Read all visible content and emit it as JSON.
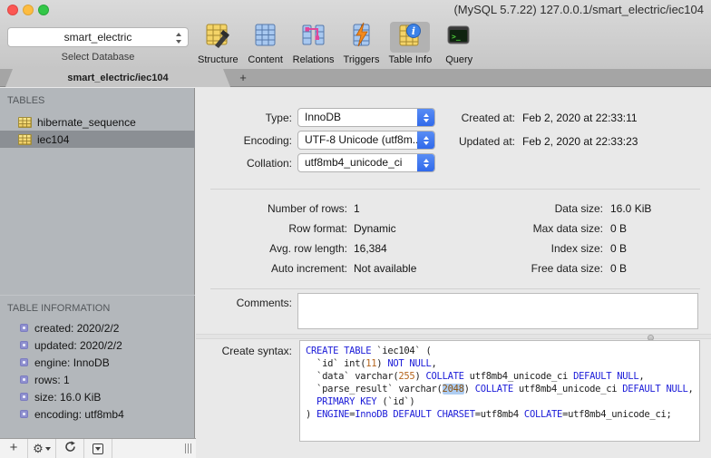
{
  "window": {
    "title": "(MySQL 5.7.22) 127.0.0.1/smart_electric/iec104"
  },
  "toolbar": {
    "database_select": {
      "value": "smart_electric",
      "label": "Select Database"
    },
    "buttons": [
      {
        "label": "Structure",
        "active": false
      },
      {
        "label": "Content",
        "active": false
      },
      {
        "label": "Relations",
        "active": false
      },
      {
        "label": "Triggers",
        "active": false
      },
      {
        "label": "Table Info",
        "active": true
      },
      {
        "label": "Query",
        "active": false
      }
    ]
  },
  "tabbar": {
    "active_tab": "smart_electric/iec104",
    "new_tab": "+"
  },
  "sidebar": {
    "tables_header": "TABLES",
    "tables": [
      {
        "name": "hibernate_sequence",
        "selected": false
      },
      {
        "name": "iec104",
        "selected": true
      }
    ],
    "info_header": "TABLE INFORMATION",
    "info_items": [
      "created: 2020/2/2",
      "updated: 2020/2/2",
      "engine: InnoDB",
      "rows: 1",
      "size: 16.0 KiB",
      "encoding: utf8mb4"
    ]
  },
  "main": {
    "type": {
      "label": "Type:",
      "value": "InnoDB"
    },
    "encoding": {
      "label": "Encoding:",
      "value": "UTF-8 Unicode (utf8m..."
    },
    "collation": {
      "label": "Collation:",
      "value": "utf8mb4_unicode_ci"
    },
    "created": {
      "label": "Created at:",
      "value": "Feb 2, 2020 at 22:33:11"
    },
    "updated": {
      "label": "Updated at:",
      "value": "Feb 2, 2020 at 22:33:23"
    },
    "stats_left": [
      {
        "label": "Number of rows:",
        "value": "1"
      },
      {
        "label": "Row format:",
        "value": "Dynamic"
      },
      {
        "label": "Avg. row length:",
        "value": "16,384"
      },
      {
        "label": "Auto increment:",
        "value": "Not available"
      }
    ],
    "stats_right": [
      {
        "label": "Data size:",
        "value": "16.0 KiB"
      },
      {
        "label": "Max data size:",
        "value": "0 B"
      },
      {
        "label": "Index size:",
        "value": "0 B"
      },
      {
        "label": "Free data size:",
        "value": "0 B"
      }
    ],
    "comments": {
      "label": "Comments:",
      "value": ""
    },
    "create_syntax": {
      "label": "Create syntax:",
      "sql_lines": [
        [
          [
            "kw",
            "CREATE TABLE"
          ],
          [
            "pl",
            " `iec104` ("
          ]
        ],
        [
          [
            "pl",
            "  `id` int("
          ],
          [
            "num",
            "11"
          ],
          [
            "pl",
            ") "
          ],
          [
            "kw",
            "NOT NULL"
          ],
          [
            "pl",
            ","
          ]
        ],
        [
          [
            "pl",
            "  `data` varchar("
          ],
          [
            "num",
            "255"
          ],
          [
            "pl",
            ") "
          ],
          [
            "kw",
            "COLLATE"
          ],
          [
            "pl",
            " utf8mb4_unicode_ci "
          ],
          [
            "kw",
            "DEFAULT NULL"
          ],
          [
            "pl",
            ","
          ]
        ],
        [
          [
            "pl",
            "  `parse_result` varchar("
          ],
          [
            "hl",
            "2048"
          ],
          [
            "pl",
            ") "
          ],
          [
            "kw",
            "COLLATE"
          ],
          [
            "pl",
            " utf8mb4_unicode_ci "
          ],
          [
            "kw",
            "DEFAULT NULL"
          ],
          [
            "pl",
            ","
          ]
        ],
        [
          [
            "pl",
            "  "
          ],
          [
            "kw",
            "PRIMARY KEY"
          ],
          [
            "pl",
            " (`id`)"
          ]
        ],
        [
          [
            "pl",
            ") "
          ],
          [
            "kw",
            "ENGINE"
          ],
          [
            "pl",
            "="
          ],
          [
            "kw",
            "InnoDB"
          ],
          [
            "pl",
            " "
          ],
          [
            "kw",
            "DEFAULT CHARSET"
          ],
          [
            "pl",
            "=utf8mb4 "
          ],
          [
            "kw",
            "COLLATE"
          ],
          [
            "pl",
            "=utf8mb4_unicode_ci;"
          ]
        ]
      ]
    }
  },
  "colors": {
    "accent_blue": "#3478f6",
    "sql_keyword": "#1c1cd8",
    "sql_number": "#b5651d",
    "sql_highlight_bg": "#aecdf2",
    "traffic_red": "#fc5753",
    "traffic_yellow": "#fdbc40",
    "traffic_green": "#33c748",
    "sidebar_bg": "#b3b7bb",
    "selected_row_bg": "#8b8f94"
  }
}
